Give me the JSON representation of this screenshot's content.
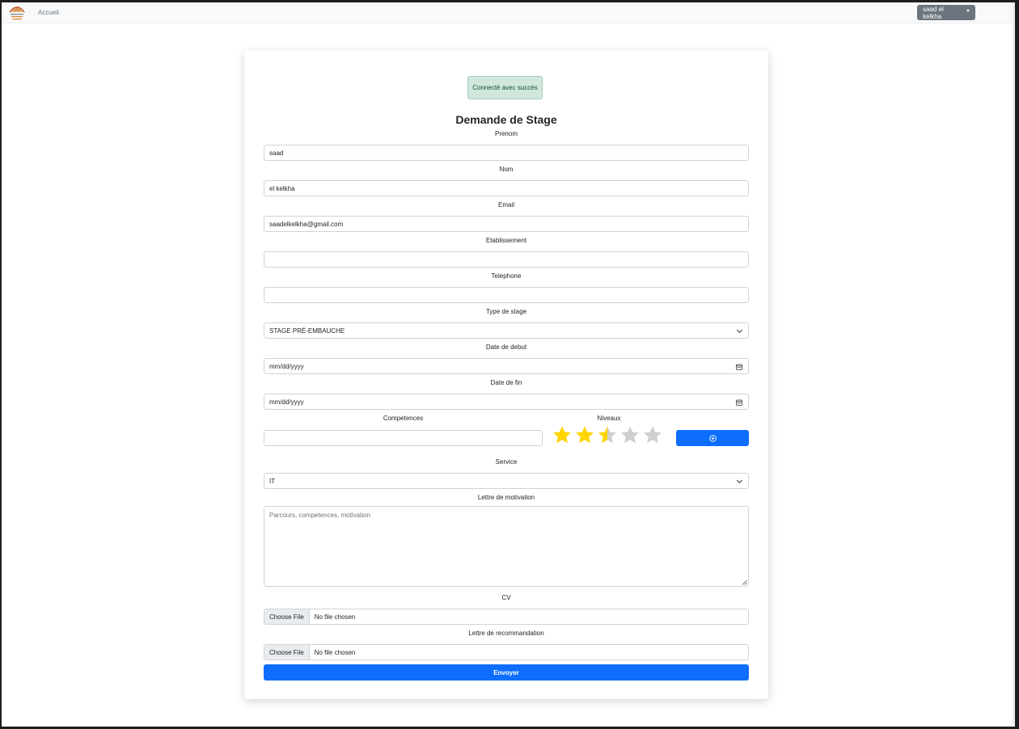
{
  "navbar": {
    "home_link": "Accueil",
    "user_menu": "saad el kelkha"
  },
  "alert": {
    "text": "Connecté avec succès"
  },
  "form": {
    "title": "Demande de Stage",
    "prenom": {
      "label": "Prenom",
      "value": "saad"
    },
    "nom": {
      "label": "Nom",
      "value": "el kelkha"
    },
    "email": {
      "label": "Email",
      "value": "saadelkelkha@gmail.com"
    },
    "etablissement": {
      "label": "Etablissement",
      "value": ""
    },
    "telephone": {
      "label": "Telephone",
      "value": ""
    },
    "type_stage": {
      "label": "Type de stage",
      "selected": "STAGE PRÉ-EMBAUCHE"
    },
    "date_debut": {
      "label": "Date de debut",
      "placeholder": "mm/dd/yyyy"
    },
    "date_fin": {
      "label": "Date de fin",
      "placeholder": "mm/dd/yyyy"
    },
    "competences": {
      "label": "Competences",
      "value": ""
    },
    "niveaux": {
      "label": "Niveaux",
      "rating": 2.5,
      "max": 5
    },
    "service": {
      "label": "Service",
      "selected": "IT"
    },
    "lettre_motivation": {
      "label": "Lettre de motivation",
      "placeholder": "Parcours, competences, motivation"
    },
    "cv": {
      "label": "CV",
      "button": "Choose File",
      "status": "No file chosen"
    },
    "lettre_recommandation": {
      "label": "Lettre de recommandation",
      "button": "Choose File",
      "status": "No file chosen"
    },
    "submit_label": "Envoyer"
  },
  "colors": {
    "primary": "#0d6efd",
    "secondary": "#6c757d",
    "success_bg": "#d1e7dd",
    "star_active": "#ffd400",
    "star_inactive": "#cfcfcf"
  }
}
